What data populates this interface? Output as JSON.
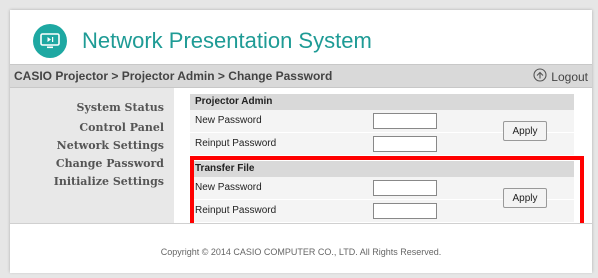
{
  "app": {
    "title": "Network Presentation System",
    "logo_icon": "screen-play-icon",
    "accent_color": "#1ea8a2"
  },
  "breadcrumb": {
    "text": "CASIO Projector > Projector Admin > Change Password",
    "logout_label": "Logout",
    "logout_icon": "power-icon"
  },
  "sidebar": {
    "items": [
      {
        "label": "System Status"
      },
      {
        "label": "Control Panel"
      },
      {
        "label": "Network Settings"
      },
      {
        "label": "Change Password"
      },
      {
        "label": "Initialize Settings"
      }
    ]
  },
  "sections": [
    {
      "title": "Projector Admin",
      "fields": [
        {
          "label": "New Password",
          "value": ""
        },
        {
          "label": "Reinput Password",
          "value": ""
        }
      ],
      "apply_label": "Apply"
    },
    {
      "title": "Transfer File",
      "fields": [
        {
          "label": "New Password",
          "value": ""
        },
        {
          "label": "Reinput Password",
          "value": ""
        }
      ],
      "apply_label": "Apply"
    }
  ],
  "footer": {
    "copyright": "Copyright © 2014 CASIO COMPUTER CO., LTD. All Rights Reserved."
  },
  "highlight_color": "#ff0000"
}
